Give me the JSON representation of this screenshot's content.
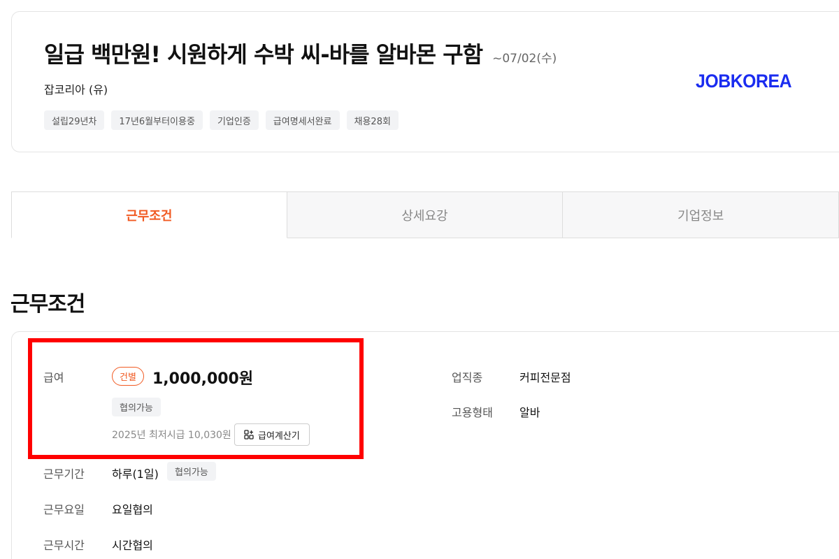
{
  "header": {
    "title": "일급 백만원! 시원하게 수박 씨-바를 알바몬 구함",
    "deadline": "~07/02(수)",
    "company": "잡코리아 (유)",
    "logo_text": "JOBKOREA",
    "tags": [
      "설립29년차",
      "17년6월부터이용중",
      "기업인증",
      "급여명세서완료",
      "채용28회"
    ]
  },
  "tabs": [
    {
      "label": "근무조건",
      "active": true
    },
    {
      "label": "상세요강",
      "active": false
    },
    {
      "label": "기업정보",
      "active": false
    }
  ],
  "section": {
    "title": "근무조건"
  },
  "conditions": {
    "salary": {
      "label": "급여",
      "pay_type": "건별",
      "amount": "1,000,000원",
      "negotiable": "협의가능",
      "min_wage": "2025년 최저시급 10,030원",
      "calc_button": "급여계산기"
    },
    "period": {
      "label": "근무기간",
      "value": "하루(1일)",
      "negotiable": "협의가능"
    },
    "days": {
      "label": "근무요일",
      "value": "요일협의"
    },
    "hours": {
      "label": "근무시간",
      "value": "시간협의"
    },
    "industry": {
      "label": "업직종",
      "value": "커피전문점"
    },
    "employment": {
      "label": "고용형태",
      "value": "알바"
    }
  },
  "colors": {
    "accent": "#f15a22",
    "logo": "#1a2cf0",
    "highlight": "#ff0000"
  }
}
